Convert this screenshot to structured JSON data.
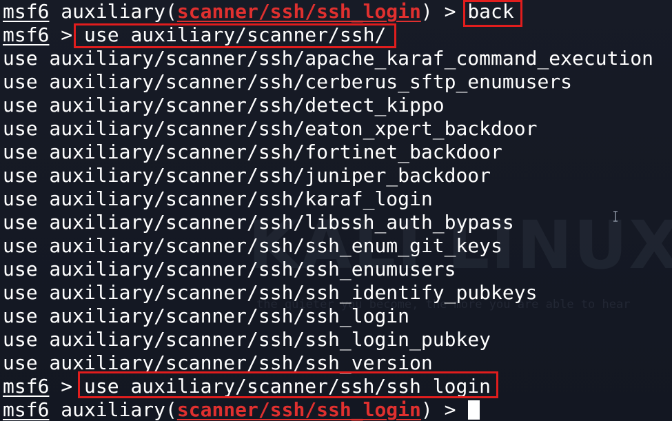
{
  "watermark": {
    "logo": "KALI LINUX",
    "tagline": "the quieter you become, the more you are able to hear"
  },
  "session": {
    "prompt": "msf6",
    "open_paren": " auxiliary(",
    "close_and_caret": ") > ",
    "caret": " > ",
    "module_text": "scanner/ssh/ssh_login",
    "command_back": "back",
    "command_use_partial": "use auxiliary/scanner/ssh/",
    "command_use_full": "use auxiliary/scanner/ssh/ssh_login"
  },
  "completions": [
    "use auxiliary/scanner/ssh/apache_karaf_command_execution",
    "use auxiliary/scanner/ssh/cerberus_sftp_enumusers",
    "use auxiliary/scanner/ssh/detect_kippo",
    "use auxiliary/scanner/ssh/eaton_xpert_backdoor",
    "use auxiliary/scanner/ssh/fortinet_backdoor",
    "use auxiliary/scanner/ssh/juniper_backdoor",
    "use auxiliary/scanner/ssh/karaf_login",
    "use auxiliary/scanner/ssh/libssh_auth_bypass",
    "use auxiliary/scanner/ssh/ssh_enum_git_keys",
    "use auxiliary/scanner/ssh/ssh_enumusers",
    "use auxiliary/scanner/ssh/ssh_identify_pubkeys",
    "use auxiliary/scanner/ssh/ssh_login",
    "use auxiliary/scanner/ssh/ssh_login_pubkey",
    "use auxiliary/scanner/ssh/ssh_version"
  ],
  "colors": {
    "background": "#141821",
    "text": "#ffffff",
    "module": "#e0302f",
    "highlight_box": "#e11d1d"
  },
  "icons": {
    "cursor": "block-cursor",
    "pointer": "text-ibeam-icon"
  }
}
